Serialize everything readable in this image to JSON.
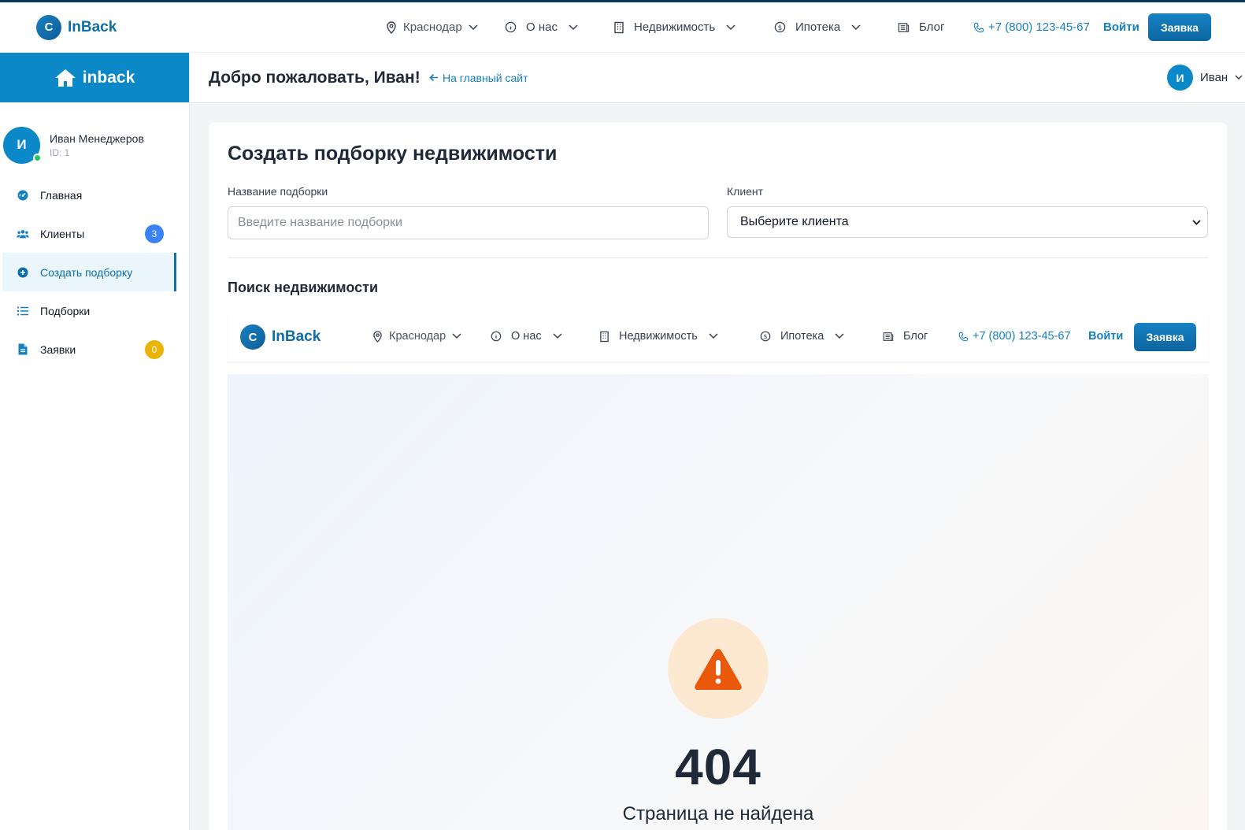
{
  "site_nav": {
    "logo_letter": "C",
    "logo_text": "InBack",
    "city": "Краснодар",
    "about": "О нас",
    "realty": "Недвижимость",
    "mortgage": "Ипотека",
    "blog": "Блог",
    "phone": "+7 (800) 123-45-67",
    "login": "Войти",
    "request": "Заявка"
  },
  "sidebar": {
    "brand": "inback",
    "user_initial": "И",
    "user_name": "Иван Менеджеров",
    "user_id": "ID: 1",
    "items": [
      {
        "label": "Главная",
        "icon": "dashboard-icon"
      },
      {
        "label": "Клиенты",
        "icon": "users-icon",
        "badge": "3",
        "badge_color": "#3b82f6"
      },
      {
        "label": "Создать подборку",
        "icon": "plus-circle-icon",
        "active": true
      },
      {
        "label": "Подборки",
        "icon": "list-icon"
      },
      {
        "label": "Заявки",
        "icon": "file-icon",
        "badge": "0",
        "badge_color": "#eab308"
      }
    ]
  },
  "header": {
    "welcome": "Добро пожаловать, Иван!",
    "home_link": "На главный сайт",
    "user_initial": "И",
    "user_name": "Иван"
  },
  "form": {
    "title": "Создать подборку недвижимости",
    "name_label": "Название подборки",
    "name_placeholder": "Введите название подборки",
    "client_label": "Клиент",
    "client_selected": "Выберите клиента",
    "search_title": "Поиск недвижимости"
  },
  "error": {
    "code": "404",
    "message": "Страница не найдена"
  },
  "colors": {
    "brand": "#0a88c7",
    "accent_link": "#1580bf",
    "warning": "#ea580c"
  }
}
